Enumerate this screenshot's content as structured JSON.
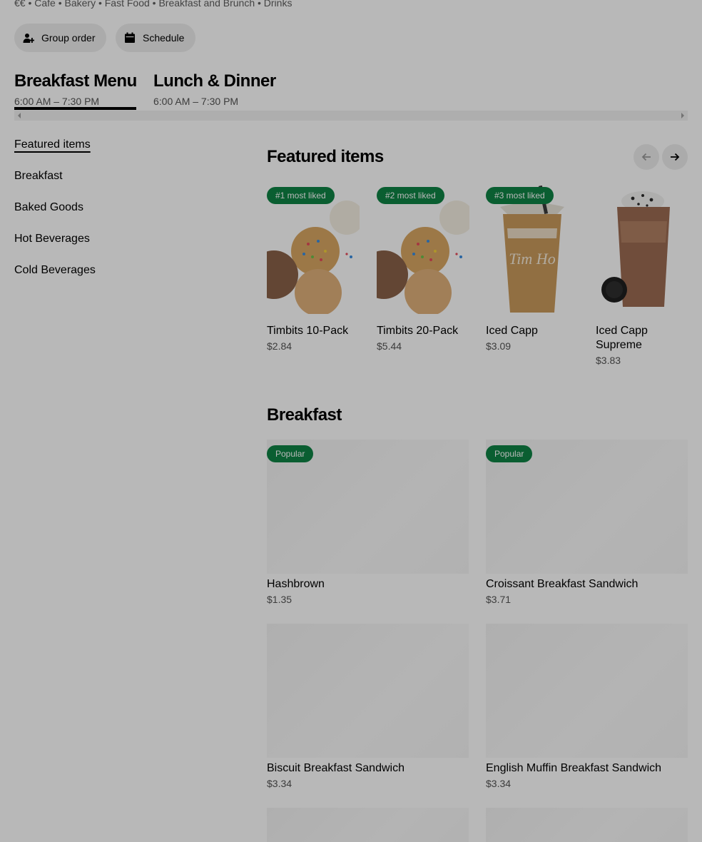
{
  "store": {
    "tagline": "€€ • Cafe • Bakery • Fast Food • Breakfast and Brunch • Drinks"
  },
  "actions": {
    "group_order": "Group order",
    "schedule": "Schedule"
  },
  "menus": [
    {
      "title": "Breakfast Menu",
      "hours": "6:00 AM – 7:30 PM"
    },
    {
      "title": "Lunch & Dinner",
      "hours": "6:00 AM – 7:30 PM"
    }
  ],
  "sidebar": {
    "items": [
      {
        "label": "Featured items"
      },
      {
        "label": "Breakfast"
      },
      {
        "label": "Baked Goods"
      },
      {
        "label": "Hot Beverages"
      },
      {
        "label": "Cold Beverages"
      }
    ]
  },
  "featured": {
    "title": "Featured items",
    "items": [
      {
        "badge": "#1 most liked",
        "name": "Timbits 10-Pack",
        "price": "$2.84",
        "icon": "timbits-image"
      },
      {
        "badge": "#2 most liked",
        "name": "Timbits 20-Pack",
        "price": "$5.44",
        "icon": "timbits-image"
      },
      {
        "badge": "#3 most liked",
        "name": "Iced Capp",
        "price": "$3.09",
        "icon": "iced-capp-image"
      },
      {
        "badge": "",
        "name": "Iced Capp Supreme",
        "price": "$3.83",
        "icon": "iced-capp-supreme-image"
      }
    ]
  },
  "breakfast": {
    "title": "Breakfast",
    "items": [
      {
        "badge": "Popular",
        "name": "Hashbrown",
        "price": "$1.35"
      },
      {
        "badge": "Popular",
        "name": "Croissant Breakfast Sandwich",
        "price": "$3.71"
      },
      {
        "badge": "",
        "name": "Biscuit Breakfast Sandwich",
        "price": "$3.34"
      },
      {
        "badge": "",
        "name": "English Muffin Breakfast Sandwich",
        "price": "$3.34"
      }
    ]
  },
  "colors": {
    "badge_green": "#0e8345",
    "pill_bg": "#eeeeee",
    "overlay": "rgba(0,0,0,0.28)"
  }
}
